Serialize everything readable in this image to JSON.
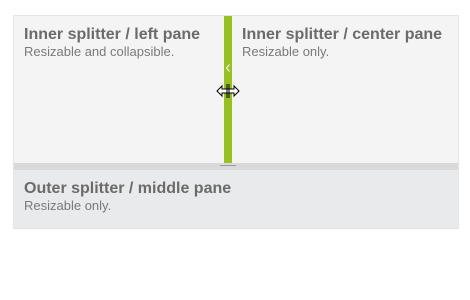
{
  "inner_splitter": {
    "left_pane": {
      "title": "Inner splitter / left pane",
      "description": "Resizable and collapsible."
    },
    "center_pane": {
      "title": "Inner splitter / center pane",
      "description": "Resizable only."
    },
    "splitbar": {
      "color": "#96c11f",
      "collapse_icon": "chevron-left-icon"
    }
  },
  "outer_splitter": {
    "middle_pane": {
      "title": "Outer splitter / middle pane",
      "description": "Resizable only."
    }
  },
  "cursor": {
    "icon": "horizontal-resize-cursor-icon"
  }
}
